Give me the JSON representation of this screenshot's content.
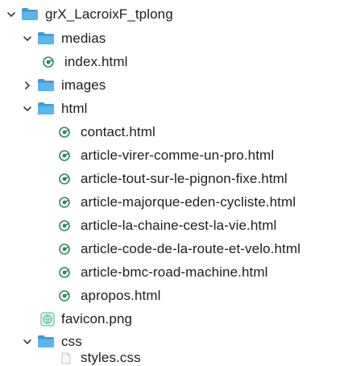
{
  "colors": {
    "folder_blue": "#5ab6ec",
    "folder_blue_dark": "#3a9bd9",
    "chevron": "#3a3a3c",
    "text": "#1d1d1f",
    "html_file": "#2e8b57",
    "png_file": "#57c4a8"
  },
  "tree": {
    "root": {
      "label": "grX_LacroixF_tplong",
      "icon": "folder-icon",
      "expanded": true
    },
    "medias": {
      "label": "medias",
      "icon": "folder-icon",
      "expanded": true
    },
    "medias_index": {
      "label": "index.html",
      "icon": "html-file-icon"
    },
    "images": {
      "label": "images",
      "icon": "folder-icon",
      "expanded": false
    },
    "html": {
      "label": "html",
      "icon": "folder-icon",
      "expanded": true
    },
    "html_files": [
      {
        "label": "contact.html",
        "icon": "html-file-icon"
      },
      {
        "label": "article-virer-comme-un-pro.html",
        "icon": "html-file-icon"
      },
      {
        "label": "article-tout-sur-le-pignon-fixe.html",
        "icon": "html-file-icon"
      },
      {
        "label": "article-majorque-eden-cycliste.html",
        "icon": "html-file-icon"
      },
      {
        "label": "article-la-chaine-cest-la-vie.html",
        "icon": "html-file-icon"
      },
      {
        "label": "article-code-de-la-route-et-velo.html",
        "icon": "html-file-icon"
      },
      {
        "label": "article-bmc-road-machine.html",
        "icon": "html-file-icon"
      },
      {
        "label": "apropos.html",
        "icon": "html-file-icon"
      }
    ],
    "favicon": {
      "label": "favicon.png",
      "icon": "image-file-icon"
    },
    "css": {
      "label": "css",
      "icon": "folder-icon",
      "expanded": true
    },
    "css_styles": {
      "label": "styles.css",
      "icon": "css-file-icon"
    }
  }
}
